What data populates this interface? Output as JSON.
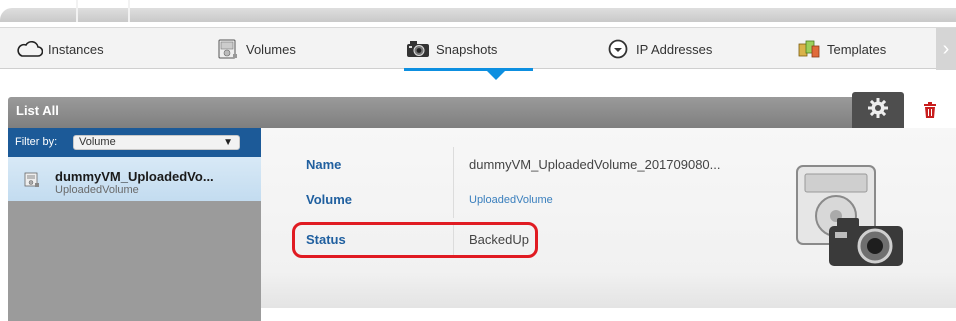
{
  "tabs": [
    {
      "label": "Instances",
      "icon": "cloud-icon"
    },
    {
      "label": "Volumes",
      "icon": "disk-volume-icon"
    },
    {
      "label": "Snapshots",
      "icon": "camera-icon",
      "active": true
    },
    {
      "label": "IP Addresses",
      "icon": "ip-address-icon"
    },
    {
      "label": "Templates",
      "icon": "templates-icon"
    }
  ],
  "list_header": {
    "title": "List All",
    "actions": [
      "gear-icon",
      "trash-icon"
    ]
  },
  "filter": {
    "label": "Filter by:",
    "selected": "Volume"
  },
  "snapshot_list": [
    {
      "name": "dummyVM_UploadedVo...",
      "subtitle": "UploadedVolume"
    }
  ],
  "details": {
    "rows": [
      {
        "label": "Name",
        "value": "dummyVM_UploadedVolume_201709080..."
      },
      {
        "label": "Volume",
        "value": "UploadedVolume"
      },
      {
        "label": "Status",
        "value": "BackedUp"
      }
    ]
  },
  "colors": {
    "accent": "#0d8fe0",
    "filter_bg": "#1c5a98",
    "label": "#1f5f9f",
    "highlight": "#e01b22"
  }
}
